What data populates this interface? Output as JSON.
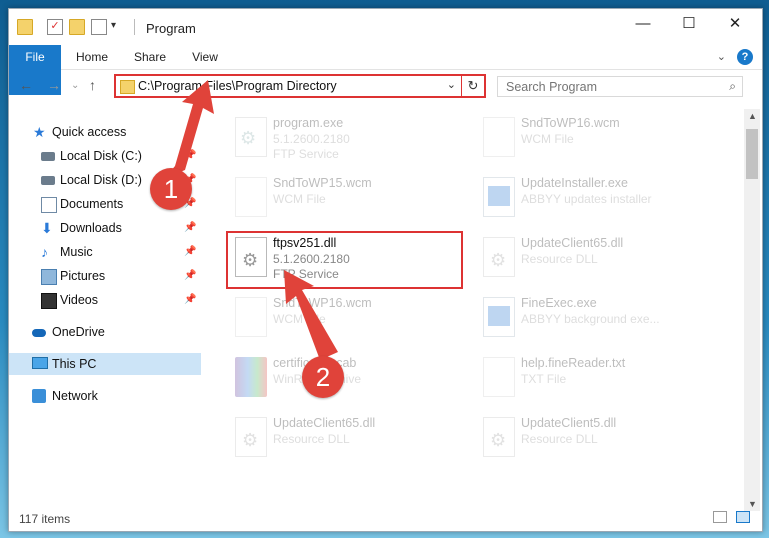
{
  "window": {
    "title": "Program"
  },
  "ribbon": {
    "tabs": [
      "File",
      "Home",
      "Share",
      "View"
    ],
    "help": "?"
  },
  "address": {
    "path": "C:\\Program Files\\Program Directory",
    "search_placeholder": "Search Program"
  },
  "sidebar": {
    "items": [
      {
        "label": "Quick access",
        "icon": "star-icon"
      },
      {
        "label": "Local Disk (C:)",
        "icon": "drive-icon"
      },
      {
        "label": "Local Disk (D:)",
        "icon": "drive-icon"
      },
      {
        "label": "Documents",
        "icon": "documents-icon"
      },
      {
        "label": "Downloads",
        "icon": "downloads-icon"
      },
      {
        "label": "Music",
        "icon": "music-icon"
      },
      {
        "label": "Pictures",
        "icon": "pictures-icon"
      },
      {
        "label": "Videos",
        "icon": "videos-icon"
      },
      {
        "label": "OneDrive",
        "icon": "onedrive-icon"
      },
      {
        "label": "This PC",
        "icon": "computer-icon"
      },
      {
        "label": "Network",
        "icon": "network-icon"
      }
    ]
  },
  "files": [
    {
      "name": "program.exe",
      "line2": "5.1.2600.2180",
      "line3": "FTP Service"
    },
    {
      "name": "SndToWP16.wcm",
      "line2": "WCM File",
      "line3": ""
    },
    {
      "name": "SndToWP15.wcm",
      "line2": "WCM File",
      "line3": ""
    },
    {
      "name": "UpdateInstaller.exe",
      "line2": "ABBYY updates installer",
      "line3": ""
    },
    {
      "name": "ftpsv251.dll",
      "line2": "5.1.2600.2180",
      "line3": "FTP Service"
    },
    {
      "name": "UpdateClient65.dll",
      "line2": "Resource DLL",
      "line3": ""
    },
    {
      "name": "SndToWP16.wcm",
      "line2": "WCM File",
      "line3": ""
    },
    {
      "name": "FineExec.exe",
      "line2": "ABBYY background exe...",
      "line3": ""
    },
    {
      "name": "certificates.cab",
      "line2": "WinRAR archive",
      "line3": ""
    },
    {
      "name": "help.fineReader.txt",
      "line2": "TXT File",
      "line3": ""
    },
    {
      "name": "UpdateClient65.dll",
      "line2": "Resource DLL",
      "line3": ""
    },
    {
      "name": "UpdateClient5.dll",
      "line2": "Resource DLL",
      "line3": ""
    }
  ],
  "status": {
    "count": "117 items"
  },
  "annotations": {
    "step1": "1",
    "step2": "2"
  },
  "colors": {
    "accent": "#1979ca",
    "highlight": "#dd3333",
    "badge": "#e0433a"
  }
}
